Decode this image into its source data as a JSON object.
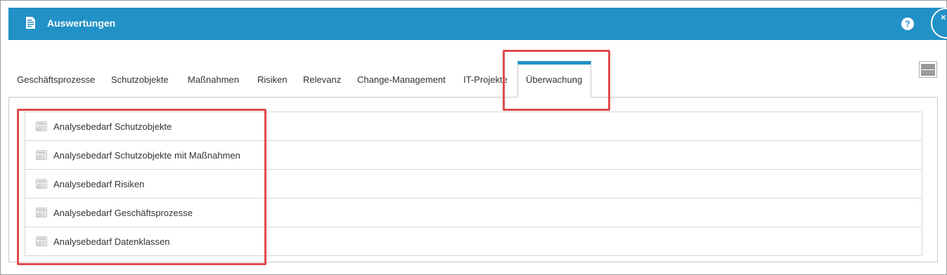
{
  "window": {
    "title": "Auswertungen",
    "help_label": "?",
    "close_label": "×"
  },
  "tabs": [
    {
      "label": "Geschäftsprozesse",
      "active": false
    },
    {
      "label": "Schutzobjekte",
      "active": false
    },
    {
      "label": "Maßnahmen",
      "active": false
    },
    {
      "label": "Risiken",
      "active": false
    },
    {
      "label": "Relevanz",
      "active": false
    },
    {
      "label": "Change-Management",
      "active": false
    },
    {
      "label": "IT-Projekte",
      "active": false
    },
    {
      "label": "Überwachung",
      "active": true
    }
  ],
  "reports": [
    {
      "label": "Analysebedarf Schutzobjekte",
      "icon": "report-icon"
    },
    {
      "label": "Analysebedarf Schutzobjekte mit Maßnahmen",
      "icon": "report-icon"
    },
    {
      "label": "Analysebedarf Risiken",
      "icon": "report-icon"
    },
    {
      "label": "Analysebedarf Geschäftsprozesse",
      "icon": "report-icon"
    },
    {
      "label": "Analysebedarf Datenklassen",
      "icon": "report-icon"
    }
  ],
  "colors": {
    "header": "#2191c6",
    "highlight": "#e04b4b",
    "border": "#c8c8c8"
  }
}
